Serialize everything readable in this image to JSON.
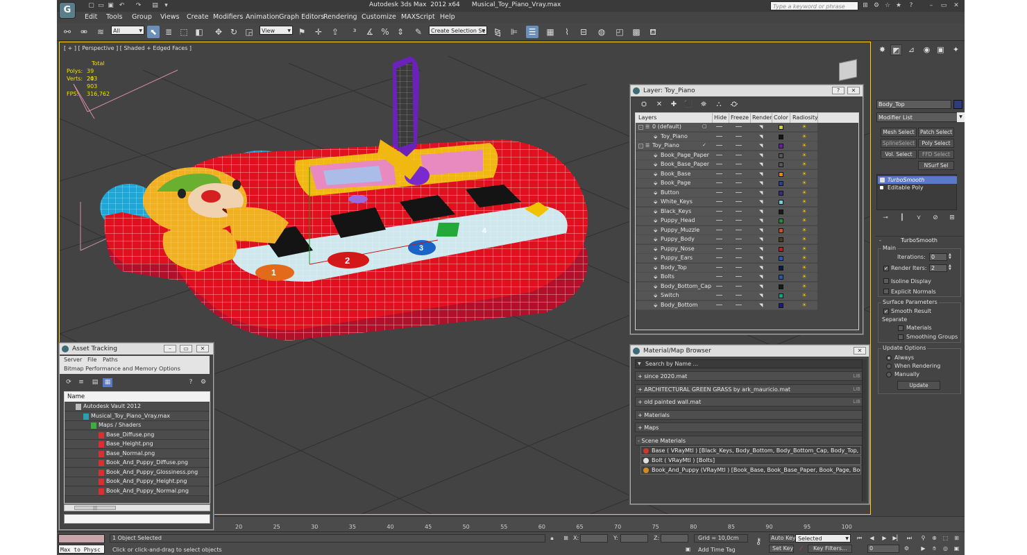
{
  "app": {
    "title": "Autodesk 3ds Max  2012 x64      Musical_Toy_Piano_Vray.max",
    "logo_icon": "3dsmax-logo-icon",
    "search_placeholder": "Type a keyword or phrase"
  },
  "menu": [
    "Edit",
    "Tools",
    "Group",
    "Views",
    "Create",
    "Modifiers",
    "Animation",
    "Graph Editors",
    "Rendering",
    "Customize",
    "MAXScript",
    "Help"
  ],
  "toolbar": {
    "selection_filter": "All",
    "ref_coord": "View",
    "named_selection": "Create Selection Se"
  },
  "viewport": {
    "label": "[ + ] [ Perspective ] [ Shaded + Edged Faces ]",
    "stats_header": "Total",
    "polys_label": "Polys:",
    "polys_value": "39 243",
    "verts_label": "Verts:",
    "verts_value": "20 903",
    "fps_label": "FPS:",
    "fps_value": "316,762",
    "axis_x_label": "x",
    "key_labels": [
      "1",
      "2",
      "3",
      "4"
    ]
  },
  "layer_window": {
    "title": "Layer: Toy_Piano",
    "columns": [
      "Layers",
      "Hide",
      "Freeze",
      "Render",
      "Color",
      "Radiosity"
    ],
    "rows": [
      {
        "name": "0 (default)",
        "level": 0,
        "type": "layer",
        "color": "#cfd23a"
      },
      {
        "name": "Toy_Piano",
        "level": 1,
        "type": "object",
        "color": "#151515"
      },
      {
        "name": "Toy_Piano",
        "level": 0,
        "type": "layer",
        "color": "#6a1fa0",
        "current": true
      },
      {
        "name": "Book_Page_Paper",
        "level": 1,
        "type": "object",
        "color": "#595959"
      },
      {
        "name": "Book_Base_Paper",
        "level": 1,
        "type": "object",
        "color": "#595959"
      },
      {
        "name": "Book_Base",
        "level": 1,
        "type": "object",
        "color": "#e08a14"
      },
      {
        "name": "Book_Page",
        "level": 1,
        "type": "object",
        "color": "#2a3f9a"
      },
      {
        "name": "Button",
        "level": 1,
        "type": "object",
        "color": "#3d2a86"
      },
      {
        "name": "White_Keys",
        "level": 1,
        "type": "object",
        "color": "#6fd3e0"
      },
      {
        "name": "Black_Keys",
        "level": 1,
        "type": "object",
        "color": "#1a1a1a"
      },
      {
        "name": "Puppy_Head",
        "level": 1,
        "type": "object",
        "color": "#1f8f3a"
      },
      {
        "name": "Puppy_Muzzle",
        "level": 1,
        "type": "object",
        "color": "#c8541e"
      },
      {
        "name": "Puppy_Body",
        "level": 1,
        "type": "object",
        "color": "#4a3a1e"
      },
      {
        "name": "Puppy_Nose",
        "level": 1,
        "type": "object",
        "color": "#c01e1e"
      },
      {
        "name": "Puppy_Ears",
        "level": 1,
        "type": "object",
        "color": "#245ab0"
      },
      {
        "name": "Body_Top",
        "level": 1,
        "type": "object",
        "color": "#101a3a"
      },
      {
        "name": "Bolts",
        "level": 1,
        "type": "object",
        "color": "#245ab0"
      },
      {
        "name": "Body_Bottom_Cap",
        "level": 1,
        "type": "object",
        "color": "#1a1a1a"
      },
      {
        "name": "Switch",
        "level": 1,
        "type": "object",
        "color": "#14a08c"
      },
      {
        "name": "Body_Bottom",
        "level": 1,
        "type": "object",
        "color": "#1a1a86"
      }
    ]
  },
  "material_browser": {
    "title": "Material/Map Browser",
    "search_placeholder": "Search by Name ...",
    "libraries": [
      {
        "label": "+ since 2020.mat",
        "tag": "LIB"
      },
      {
        "label": "+ ARCHITECTURAL GREEN GRASS by ark_mauricio.mat",
        "tag": "LIB"
      },
      {
        "label": "+ old painted wall.mat",
        "tag": "LIB"
      },
      {
        "label": "+ Materials",
        "tag": ""
      },
      {
        "label": "+ Maps",
        "tag": ""
      },
      {
        "label": "- Scene Materials",
        "tag": ""
      }
    ],
    "scene_materials": [
      "Base  ( VRayMtl )  [Black_Keys, Body_Bottom, Body_Bottom_Cap, Body_Top, But...",
      "Bolt  ( VRayMtl )  [Bolts]",
      "Book_And_Puppy  (VRayMtl )  [Book_Base, Book_Base_Paper, Book_Page, Book..."
    ]
  },
  "asset_tracking": {
    "title": "Asset Tracking",
    "menu1": [
      "Server",
      "File",
      "Paths"
    ],
    "menu2": [
      "Bitmap Performance and Memory",
      "Options"
    ],
    "column": "Name",
    "rows": [
      {
        "name": "Autodesk Vault 2012",
        "level": 0,
        "type": "vault"
      },
      {
        "name": "Musical_Toy_Piano_Vray.max",
        "level": 1,
        "type": "max"
      },
      {
        "name": "Maps / Shaders",
        "level": 2,
        "type": "folder"
      },
      {
        "name": "Base_Diffuse.png",
        "level": 3,
        "type": "image"
      },
      {
        "name": "Base_Height.png",
        "level": 3,
        "type": "image"
      },
      {
        "name": "Base_Normal.png",
        "level": 3,
        "type": "image"
      },
      {
        "name": "Book_And_Puppy_Diffuse.png",
        "level": 3,
        "type": "image"
      },
      {
        "name": "Book_And_Puppy_Glossiness.png",
        "level": 3,
        "type": "image"
      },
      {
        "name": "Book_And_Puppy_Height.png",
        "level": 3,
        "type": "image"
      },
      {
        "name": "Book_And_Puppy_Normal.png",
        "level": 3,
        "type": "image"
      }
    ],
    "scroll_glyph": "|||"
  },
  "command_panel": {
    "object_name": "Body_Top",
    "object_color": "#2c3d7a",
    "modifier_list": "Modifier List",
    "buttons": [
      {
        "label": "Mesh Select",
        "dim": false
      },
      {
        "label": "Patch Select",
        "dim": false
      },
      {
        "label": "SplineSelect",
        "dim": true
      },
      {
        "label": "Poly Select",
        "dim": false
      },
      {
        "label": "Vol. Select",
        "dim": false
      },
      {
        "label": "FFD Select",
        "dim": true
      },
      {
        "label": "NSurf Sel",
        "dim": false
      }
    ],
    "stack": [
      "TurboSmooth",
      "Editable Poly"
    ],
    "turbosmooth": {
      "title": "TurboSmooth",
      "main": "Main",
      "iterations_label": "Iterations:",
      "iterations": "0",
      "render_iters_label": "Render Iters:",
      "render_iters": "2",
      "isoline": "Isoline Display",
      "explicit": "Explicit Normals",
      "surface": "Surface Parameters",
      "smooth_result": "Smooth Result",
      "separate": "Separate",
      "materials": "Materials",
      "smoothing_groups": "Smoothing Groups",
      "update_options": "Update Options",
      "always": "Always",
      "when_rendering": "When Rendering",
      "manually": "Manually",
      "update": "Update"
    }
  },
  "timeline": {
    "ticks": [
      "20",
      "25",
      "30",
      "35",
      "40",
      "45",
      "50",
      "55",
      "60",
      "65",
      "70",
      "75",
      "80",
      "85",
      "90",
      "95",
      "100"
    ]
  },
  "status": {
    "maxscript": "Max to Physc",
    "selected": "1 Object Selected",
    "prompt": "Click or click-and-drag to select objects",
    "x_label": "X:",
    "y_label": "Y:",
    "z_label": "Z:",
    "grid": "Grid = 10,0cm",
    "add_time_tag": "Add Time Tag",
    "auto_key": "Auto Key",
    "set_key": "Set Key",
    "key_mode": "Selected",
    "key_filters": "Key Filters...",
    "frame": "0"
  }
}
